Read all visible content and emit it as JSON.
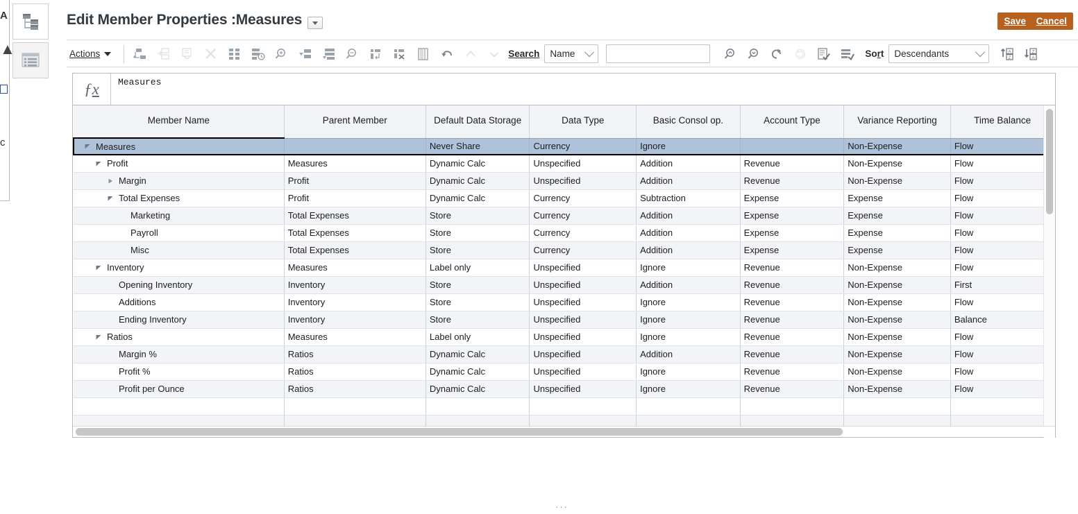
{
  "header": {
    "title": "Edit Member Properties :Measures",
    "dropdown_icon": "caret-down-icon",
    "save_label": "Save",
    "cancel_label": "Cancel",
    "accent_color": "#b8611f"
  },
  "toolbar": {
    "actions_label": "Actions",
    "search_label": "Search",
    "sort_label": "Sort",
    "search_field_value": "Name",
    "search_input_value": "",
    "sort_value": "Descendants",
    "icons_group_1": [
      "add-sibling-icon",
      "add-child-icon",
      "edit-member-icon",
      "delete-member-icon",
      "add-shared-member-icon",
      "member-history-icon",
      "zoom-in-member-icon",
      "promote-member-icon",
      "demote-member-icon"
    ],
    "icons_group_2": [
      "zoom-out-member-icon",
      "insert-row-icon",
      "delete-row-icon",
      "column-properties-icon",
      "undo-icon",
      "move-up-icon",
      "move-down-icon"
    ],
    "icons_group_3": [
      "search-previous-icon",
      "search-next-icon",
      "refresh-icon",
      "reload-icon",
      "validate-icon",
      "apply-icon"
    ],
    "icons_group_4": [
      "sort-ascending-icon",
      "sort-descending-icon"
    ]
  },
  "formula_bar": {
    "fx_icon": "function-icon",
    "value": "Measures"
  },
  "grid": {
    "columns": [
      "Member Name",
      "Parent Member",
      "Default Data Storage",
      "Data Type",
      "Basic Consol op.",
      "Account Type",
      "Variance Reporting",
      "Time Balance"
    ],
    "rows": [
      {
        "member_name": "Measures",
        "indent": 0,
        "twisty": "expanded",
        "parent_member": "",
        "default_data_storage": "Never Share",
        "data_type": "Currency",
        "basic_consol_op": "Ignore",
        "account_type": "",
        "variance_reporting": "Non-Expense",
        "time_balance": "Flow",
        "selected": true
      },
      {
        "member_name": "Profit",
        "indent": 1,
        "twisty": "expanded",
        "parent_member": "Measures",
        "default_data_storage": "Dynamic Calc",
        "data_type": "Unspecified",
        "basic_consol_op": "Addition",
        "account_type": "Revenue",
        "variance_reporting": "Non-Expense",
        "time_balance": "Flow",
        "selected": false
      },
      {
        "member_name": "Margin",
        "indent": 2,
        "twisty": "collapsed",
        "parent_member": "Profit",
        "default_data_storage": "Dynamic Calc",
        "data_type": "Unspecified",
        "basic_consol_op": "Addition",
        "account_type": "Revenue",
        "variance_reporting": "Non-Expense",
        "time_balance": "Flow",
        "selected": false
      },
      {
        "member_name": "Total Expenses",
        "indent": 2,
        "twisty": "expanded",
        "parent_member": "Profit",
        "default_data_storage": "Dynamic Calc",
        "data_type": "Currency",
        "basic_consol_op": "Subtraction",
        "account_type": "Expense",
        "variance_reporting": "Expense",
        "time_balance": "Flow",
        "selected": false
      },
      {
        "member_name": "Marketing",
        "indent": 3,
        "twisty": "none",
        "parent_member": "Total Expenses",
        "default_data_storage": "Store",
        "data_type": "Currency",
        "basic_consol_op": "Addition",
        "account_type": "Expense",
        "variance_reporting": "Expense",
        "time_balance": "Flow",
        "selected": false
      },
      {
        "member_name": "Payroll",
        "indent": 3,
        "twisty": "none",
        "parent_member": "Total Expenses",
        "default_data_storage": "Store",
        "data_type": "Currency",
        "basic_consol_op": "Addition",
        "account_type": "Expense",
        "variance_reporting": "Expense",
        "time_balance": "Flow",
        "selected": false
      },
      {
        "member_name": "Misc",
        "indent": 3,
        "twisty": "none",
        "parent_member": "Total Expenses",
        "default_data_storage": "Store",
        "data_type": "Currency",
        "basic_consol_op": "Addition",
        "account_type": "Expense",
        "variance_reporting": "Expense",
        "time_balance": "Flow",
        "selected": false
      },
      {
        "member_name": "Inventory",
        "indent": 1,
        "twisty": "expanded",
        "parent_member": "Measures",
        "default_data_storage": "Label only",
        "data_type": "Unspecified",
        "basic_consol_op": "Ignore",
        "account_type": "Revenue",
        "variance_reporting": "Non-Expense",
        "time_balance": "Flow",
        "selected": false
      },
      {
        "member_name": "Opening Inventory",
        "indent": 2,
        "twisty": "none",
        "parent_member": "Inventory",
        "default_data_storage": "Store",
        "data_type": "Unspecified",
        "basic_consol_op": "Addition",
        "account_type": "Revenue",
        "variance_reporting": "Non-Expense",
        "time_balance": "First",
        "selected": false
      },
      {
        "member_name": "Additions",
        "indent": 2,
        "twisty": "none",
        "parent_member": "Inventory",
        "default_data_storage": "Store",
        "data_type": "Unspecified",
        "basic_consol_op": "Ignore",
        "account_type": "Revenue",
        "variance_reporting": "Non-Expense",
        "time_balance": "Flow",
        "selected": false
      },
      {
        "member_name": "Ending Inventory",
        "indent": 2,
        "twisty": "none",
        "parent_member": "Inventory",
        "default_data_storage": "Store",
        "data_type": "Unspecified",
        "basic_consol_op": "Ignore",
        "account_type": "Revenue",
        "variance_reporting": "Non-Expense",
        "time_balance": "Balance",
        "selected": false
      },
      {
        "member_name": "Ratios",
        "indent": 1,
        "twisty": "expanded",
        "parent_member": "Measures",
        "default_data_storage": "Label only",
        "data_type": "Unspecified",
        "basic_consol_op": "Ignore",
        "account_type": "Revenue",
        "variance_reporting": "Non-Expense",
        "time_balance": "Flow",
        "selected": false
      },
      {
        "member_name": "Margin %",
        "indent": 2,
        "twisty": "none",
        "parent_member": "Ratios",
        "default_data_storage": "Dynamic Calc",
        "data_type": "Unspecified",
        "basic_consol_op": "Addition",
        "account_type": "Revenue",
        "variance_reporting": "Non-Expense",
        "time_balance": "Flow",
        "selected": false
      },
      {
        "member_name": "Profit %",
        "indent": 2,
        "twisty": "none",
        "parent_member": "Ratios",
        "default_data_storage": "Dynamic Calc",
        "data_type": "Unspecified",
        "basic_consol_op": "Ignore",
        "account_type": "Revenue",
        "variance_reporting": "Non-Expense",
        "time_balance": "Flow",
        "selected": false
      },
      {
        "member_name": "Profit per Ounce",
        "indent": 2,
        "twisty": "none",
        "parent_member": "Ratios",
        "default_data_storage": "Dynamic Calc",
        "data_type": "Unspecified",
        "basic_consol_op": "Ignore",
        "account_type": "Revenue",
        "variance_reporting": "Non-Expense",
        "time_balance": "Flow",
        "selected": false
      },
      {
        "member_name": "",
        "indent": 0,
        "twisty": "none",
        "parent_member": "",
        "default_data_storage": "",
        "data_type": "",
        "basic_consol_op": "",
        "account_type": "",
        "variance_reporting": "",
        "time_balance": "",
        "selected": false
      },
      {
        "member_name": "",
        "indent": 0,
        "twisty": "none",
        "parent_member": "",
        "default_data_storage": "",
        "data_type": "",
        "basic_consol_op": "",
        "account_type": "",
        "variance_reporting": "",
        "time_balance": "",
        "selected": false
      }
    ]
  },
  "sidebar": {
    "items": [
      {
        "icon": "dimension-hierarchy-icon",
        "active": false
      },
      {
        "icon": "member-list-icon",
        "active": true
      }
    ]
  },
  "edge": {
    "glyph_1": "A",
    "glyph_2": "▲",
    "glyph_3": "c"
  },
  "bottom_status": "···"
}
